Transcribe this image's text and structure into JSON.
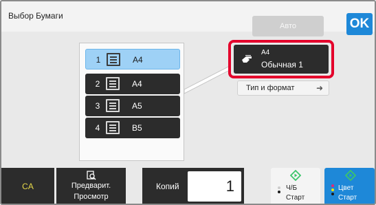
{
  "header": {
    "title": "Выбор Бумаги",
    "auto_label": "Авто",
    "ok_label": "OK"
  },
  "trays": [
    {
      "number": "1",
      "size": "A4",
      "selected": true
    },
    {
      "number": "2",
      "size": "A4",
      "selected": false
    },
    {
      "number": "3",
      "size": "A5",
      "selected": false
    },
    {
      "number": "4",
      "size": "B5",
      "selected": false
    }
  ],
  "paper_info": {
    "size": "A4",
    "type": "Обычная 1",
    "icon": "hand-paper-icon"
  },
  "type_button": {
    "label": "Тип и формат",
    "icon": "right-arrow-icon"
  },
  "bottom": {
    "ca_label": "CA",
    "preview_line1": "Предварит.",
    "preview_line2": "Просмотр",
    "copies_label": "Копий",
    "copies_value": "1",
    "bw_line1": "Ч/Б",
    "bw_line2": "Старт",
    "color_line1": "Цвет",
    "color_line2": "Старт"
  },
  "colors": {
    "accent": "#1e88d8",
    "dark_button": "#2c2c2c",
    "selected_tray": "#9ed1f6",
    "highlight": "#e4002b",
    "ca_text": "#e7d94a",
    "start_icon": "#3cc56a"
  }
}
